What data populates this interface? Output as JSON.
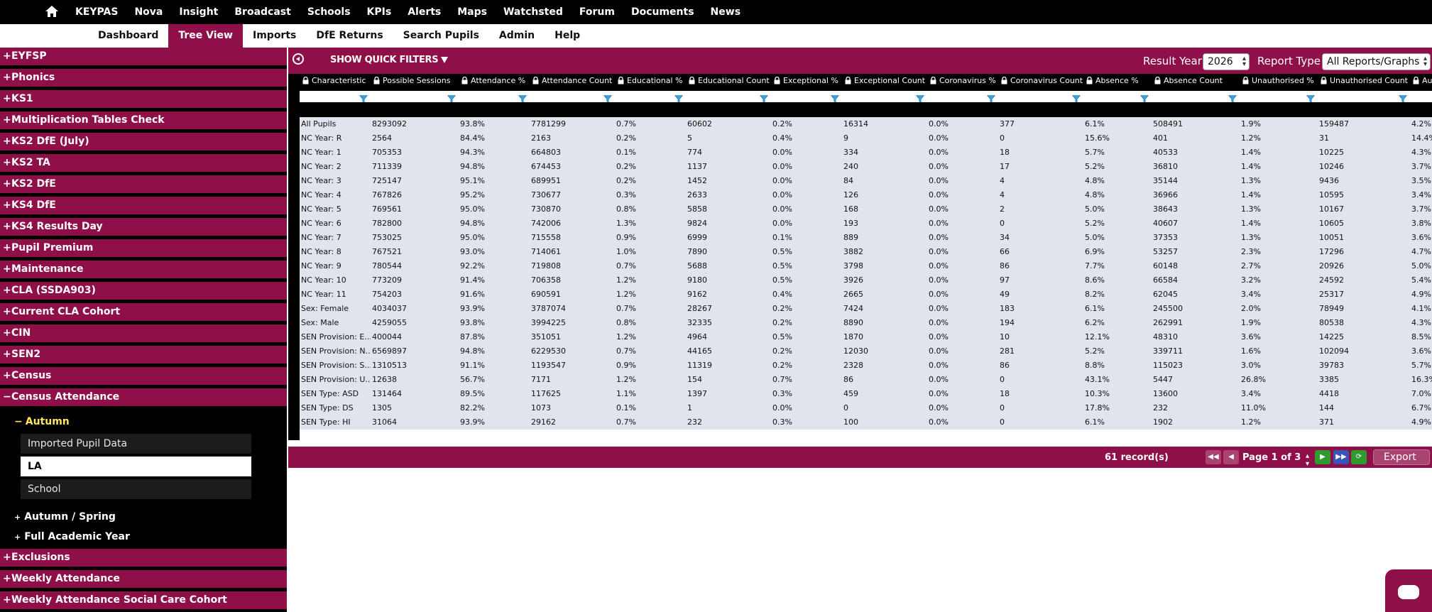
{
  "topnav": {
    "items": [
      "KEYPAS",
      "Nova",
      "Insight",
      "Broadcast",
      "Schools",
      "KPIs",
      "Alerts",
      "Maps",
      "Watchsted",
      "Forum",
      "Documents",
      "News"
    ]
  },
  "subnav": {
    "items": [
      "Dashboard",
      "Tree View",
      "Imports",
      "DfE Returns",
      "Search Pupils",
      "Admin",
      "Help"
    ],
    "active": "Tree View"
  },
  "sidebar": {
    "items": [
      {
        "sign": "+",
        "label": "EYFSP"
      },
      {
        "sign": "+",
        "label": "Phonics"
      },
      {
        "sign": "+",
        "label": "KS1"
      },
      {
        "sign": "+",
        "label": "Multiplication Tables Check"
      },
      {
        "sign": "+",
        "label": "KS2 DfE (July)"
      },
      {
        "sign": "+",
        "label": "KS2 TA"
      },
      {
        "sign": "+",
        "label": "KS2 DfE"
      },
      {
        "sign": "+",
        "label": "KS4 DfE"
      },
      {
        "sign": "+",
        "label": "KS4 Results Day"
      },
      {
        "sign": "+",
        "label": "Pupil Premium"
      },
      {
        "sign": "+",
        "label": "Maintenance"
      },
      {
        "sign": "+",
        "label": "CLA (SSDA903)"
      },
      {
        "sign": "+",
        "label": "Current CLA Cohort"
      },
      {
        "sign": "+",
        "label": "CIN"
      },
      {
        "sign": "+",
        "label": "SEN2"
      },
      {
        "sign": "+",
        "label": "Census"
      },
      {
        "sign": "−",
        "label": "Census Attendance"
      }
    ],
    "expanded": {
      "sign": "−",
      "label": "Autumn"
    },
    "leaves": [
      "Imported Pupil Data",
      "LA",
      "School"
    ],
    "selected_leaf": "LA",
    "subitems": [
      {
        "sign": "+",
        "label": "Autumn / Spring"
      },
      {
        "sign": "+",
        "label": "Full Academic Year"
      }
    ],
    "bottom_items": [
      {
        "sign": "+",
        "label": "Exclusions"
      },
      {
        "sign": "+",
        "label": "Weekly Attendance"
      },
      {
        "sign": "+",
        "label": "Weekly Attendance Social Care Cohort"
      }
    ]
  },
  "toolbar": {
    "quick_filters": "SHOW QUICK FILTERS",
    "result_year_label": "Result Year",
    "result_year": "2026",
    "report_type_label": "Report Type",
    "report_type": "All Reports/Graphs"
  },
  "grid": {
    "columns": [
      "Characteristic",
      "Possible Sessions",
      "Attendance %",
      "Attendance Count",
      "Educational %",
      "Educational Count",
      "Exceptional %",
      "Exceptional Count",
      "Coronavirus %",
      "Coronavirus Count",
      "Absence %",
      "Absence Count",
      "Unauthorised %",
      "Unauthorised Count",
      "Autho"
    ],
    "rows": [
      [
        "All Pupils",
        "8293092",
        "93.8%",
        "7781299",
        "0.7%",
        "60602",
        "0.2%",
        "16314",
        "0.0%",
        "377",
        "6.1%",
        "508491",
        "1.9%",
        "159487",
        "4.2%"
      ],
      [
        "NC Year: R",
        "2564",
        "84.4%",
        "2163",
        "0.2%",
        "5",
        "0.4%",
        "9",
        "0.0%",
        "0",
        "15.6%",
        "401",
        "1.2%",
        "31",
        "14.4%"
      ],
      [
        "NC Year: 1",
        "705353",
        "94.3%",
        "664803",
        "0.1%",
        "774",
        "0.0%",
        "334",
        "0.0%",
        "18",
        "5.7%",
        "40533",
        "1.4%",
        "10225",
        "4.3%"
      ],
      [
        "NC Year: 2",
        "711339",
        "94.8%",
        "674453",
        "0.2%",
        "1137",
        "0.0%",
        "240",
        "0.0%",
        "17",
        "5.2%",
        "36810",
        "1.4%",
        "10246",
        "3.7%"
      ],
      [
        "NC Year: 3",
        "725147",
        "95.1%",
        "689951",
        "0.2%",
        "1452",
        "0.0%",
        "84",
        "0.0%",
        "4",
        "4.8%",
        "35144",
        "1.3%",
        "9436",
        "3.5%"
      ],
      [
        "NC Year: 4",
        "767826",
        "95.2%",
        "730677",
        "0.3%",
        "2633",
        "0.0%",
        "126",
        "0.0%",
        "4",
        "4.8%",
        "36966",
        "1.4%",
        "10595",
        "3.4%"
      ],
      [
        "NC Year: 5",
        "769561",
        "95.0%",
        "730870",
        "0.8%",
        "5858",
        "0.0%",
        "168",
        "0.0%",
        "2",
        "5.0%",
        "38643",
        "1.3%",
        "10167",
        "3.7%"
      ],
      [
        "NC Year: 6",
        "782800",
        "94.8%",
        "742006",
        "1.3%",
        "9824",
        "0.0%",
        "193",
        "0.0%",
        "0",
        "5.2%",
        "40607",
        "1.4%",
        "10605",
        "3.8%"
      ],
      [
        "NC Year: 7",
        "753025",
        "95.0%",
        "715558",
        "0.9%",
        "6999",
        "0.1%",
        "889",
        "0.0%",
        "34",
        "5.0%",
        "37353",
        "1.3%",
        "10051",
        "3.6%"
      ],
      [
        "NC Year: 8",
        "767521",
        "93.0%",
        "714061",
        "1.0%",
        "7890",
        "0.5%",
        "3882",
        "0.0%",
        "66",
        "6.9%",
        "53257",
        "2.3%",
        "17296",
        "4.7%"
      ],
      [
        "NC Year: 9",
        "780544",
        "92.2%",
        "719808",
        "0.7%",
        "5688",
        "0.5%",
        "3798",
        "0.0%",
        "86",
        "7.7%",
        "60148",
        "2.7%",
        "20926",
        "5.0%"
      ],
      [
        "NC Year: 10",
        "773209",
        "91.4%",
        "706358",
        "1.2%",
        "9180",
        "0.5%",
        "3926",
        "0.0%",
        "97",
        "8.6%",
        "66584",
        "3.2%",
        "24592",
        "5.4%"
      ],
      [
        "NC Year: 11",
        "754203",
        "91.6%",
        "690591",
        "1.2%",
        "9162",
        "0.4%",
        "2665",
        "0.0%",
        "49",
        "8.2%",
        "62045",
        "3.4%",
        "25317",
        "4.9%"
      ],
      [
        "Sex: Female",
        "4034037",
        "93.9%",
        "3787074",
        "0.7%",
        "28267",
        "0.2%",
        "7424",
        "0.0%",
        "183",
        "6.1%",
        "245500",
        "2.0%",
        "78949",
        "4.1%"
      ],
      [
        "Sex: Male",
        "4259055",
        "93.8%",
        "3994225",
        "0.8%",
        "32335",
        "0.2%",
        "8890",
        "0.0%",
        "194",
        "6.2%",
        "262991",
        "1.9%",
        "80538",
        "4.3%"
      ],
      [
        "SEN Provision: E...",
        "400044",
        "87.8%",
        "351051",
        "1.2%",
        "4964",
        "0.5%",
        "1870",
        "0.0%",
        "10",
        "12.1%",
        "48310",
        "3.6%",
        "14225",
        "8.5%"
      ],
      [
        "SEN Provision: N...",
        "6569897",
        "94.8%",
        "6229530",
        "0.7%",
        "44165",
        "0.2%",
        "12030",
        "0.0%",
        "281",
        "5.2%",
        "339711",
        "1.6%",
        "102094",
        "3.6%"
      ],
      [
        "SEN Provision: S...",
        "1310513",
        "91.1%",
        "1193547",
        "0.9%",
        "11319",
        "0.2%",
        "2328",
        "0.0%",
        "86",
        "8.8%",
        "115023",
        "3.0%",
        "39783",
        "5.7%"
      ],
      [
        "SEN Provision: U...",
        "12638",
        "56.7%",
        "7171",
        "1.2%",
        "154",
        "0.7%",
        "86",
        "0.0%",
        "0",
        "43.1%",
        "5447",
        "26.8%",
        "3385",
        "16.3%"
      ],
      [
        "SEN Type: ASD",
        "131464",
        "89.5%",
        "117625",
        "1.1%",
        "1397",
        "0.3%",
        "459",
        "0.0%",
        "18",
        "10.3%",
        "13600",
        "3.4%",
        "4418",
        "7.0%"
      ],
      [
        "SEN Type: DS",
        "1305",
        "82.2%",
        "1073",
        "0.1%",
        "1",
        "0.0%",
        "0",
        "0.0%",
        "0",
        "17.8%",
        "232",
        "11.0%",
        "144",
        "6.7%"
      ],
      [
        "SEN Type: HI",
        "31064",
        "93.9%",
        "29162",
        "0.7%",
        "232",
        "0.3%",
        "100",
        "0.0%",
        "0",
        "6.1%",
        "1902",
        "1.2%",
        "371",
        "4.9%"
      ]
    ]
  },
  "pager": {
    "records": "61 record(s)",
    "page_info": "Page 1 of 3",
    "export": "Export"
  },
  "colors": {
    "brand": "#8f0f49",
    "row_bg": "#dfe4ed",
    "active_folder": "#ffe45c"
  }
}
